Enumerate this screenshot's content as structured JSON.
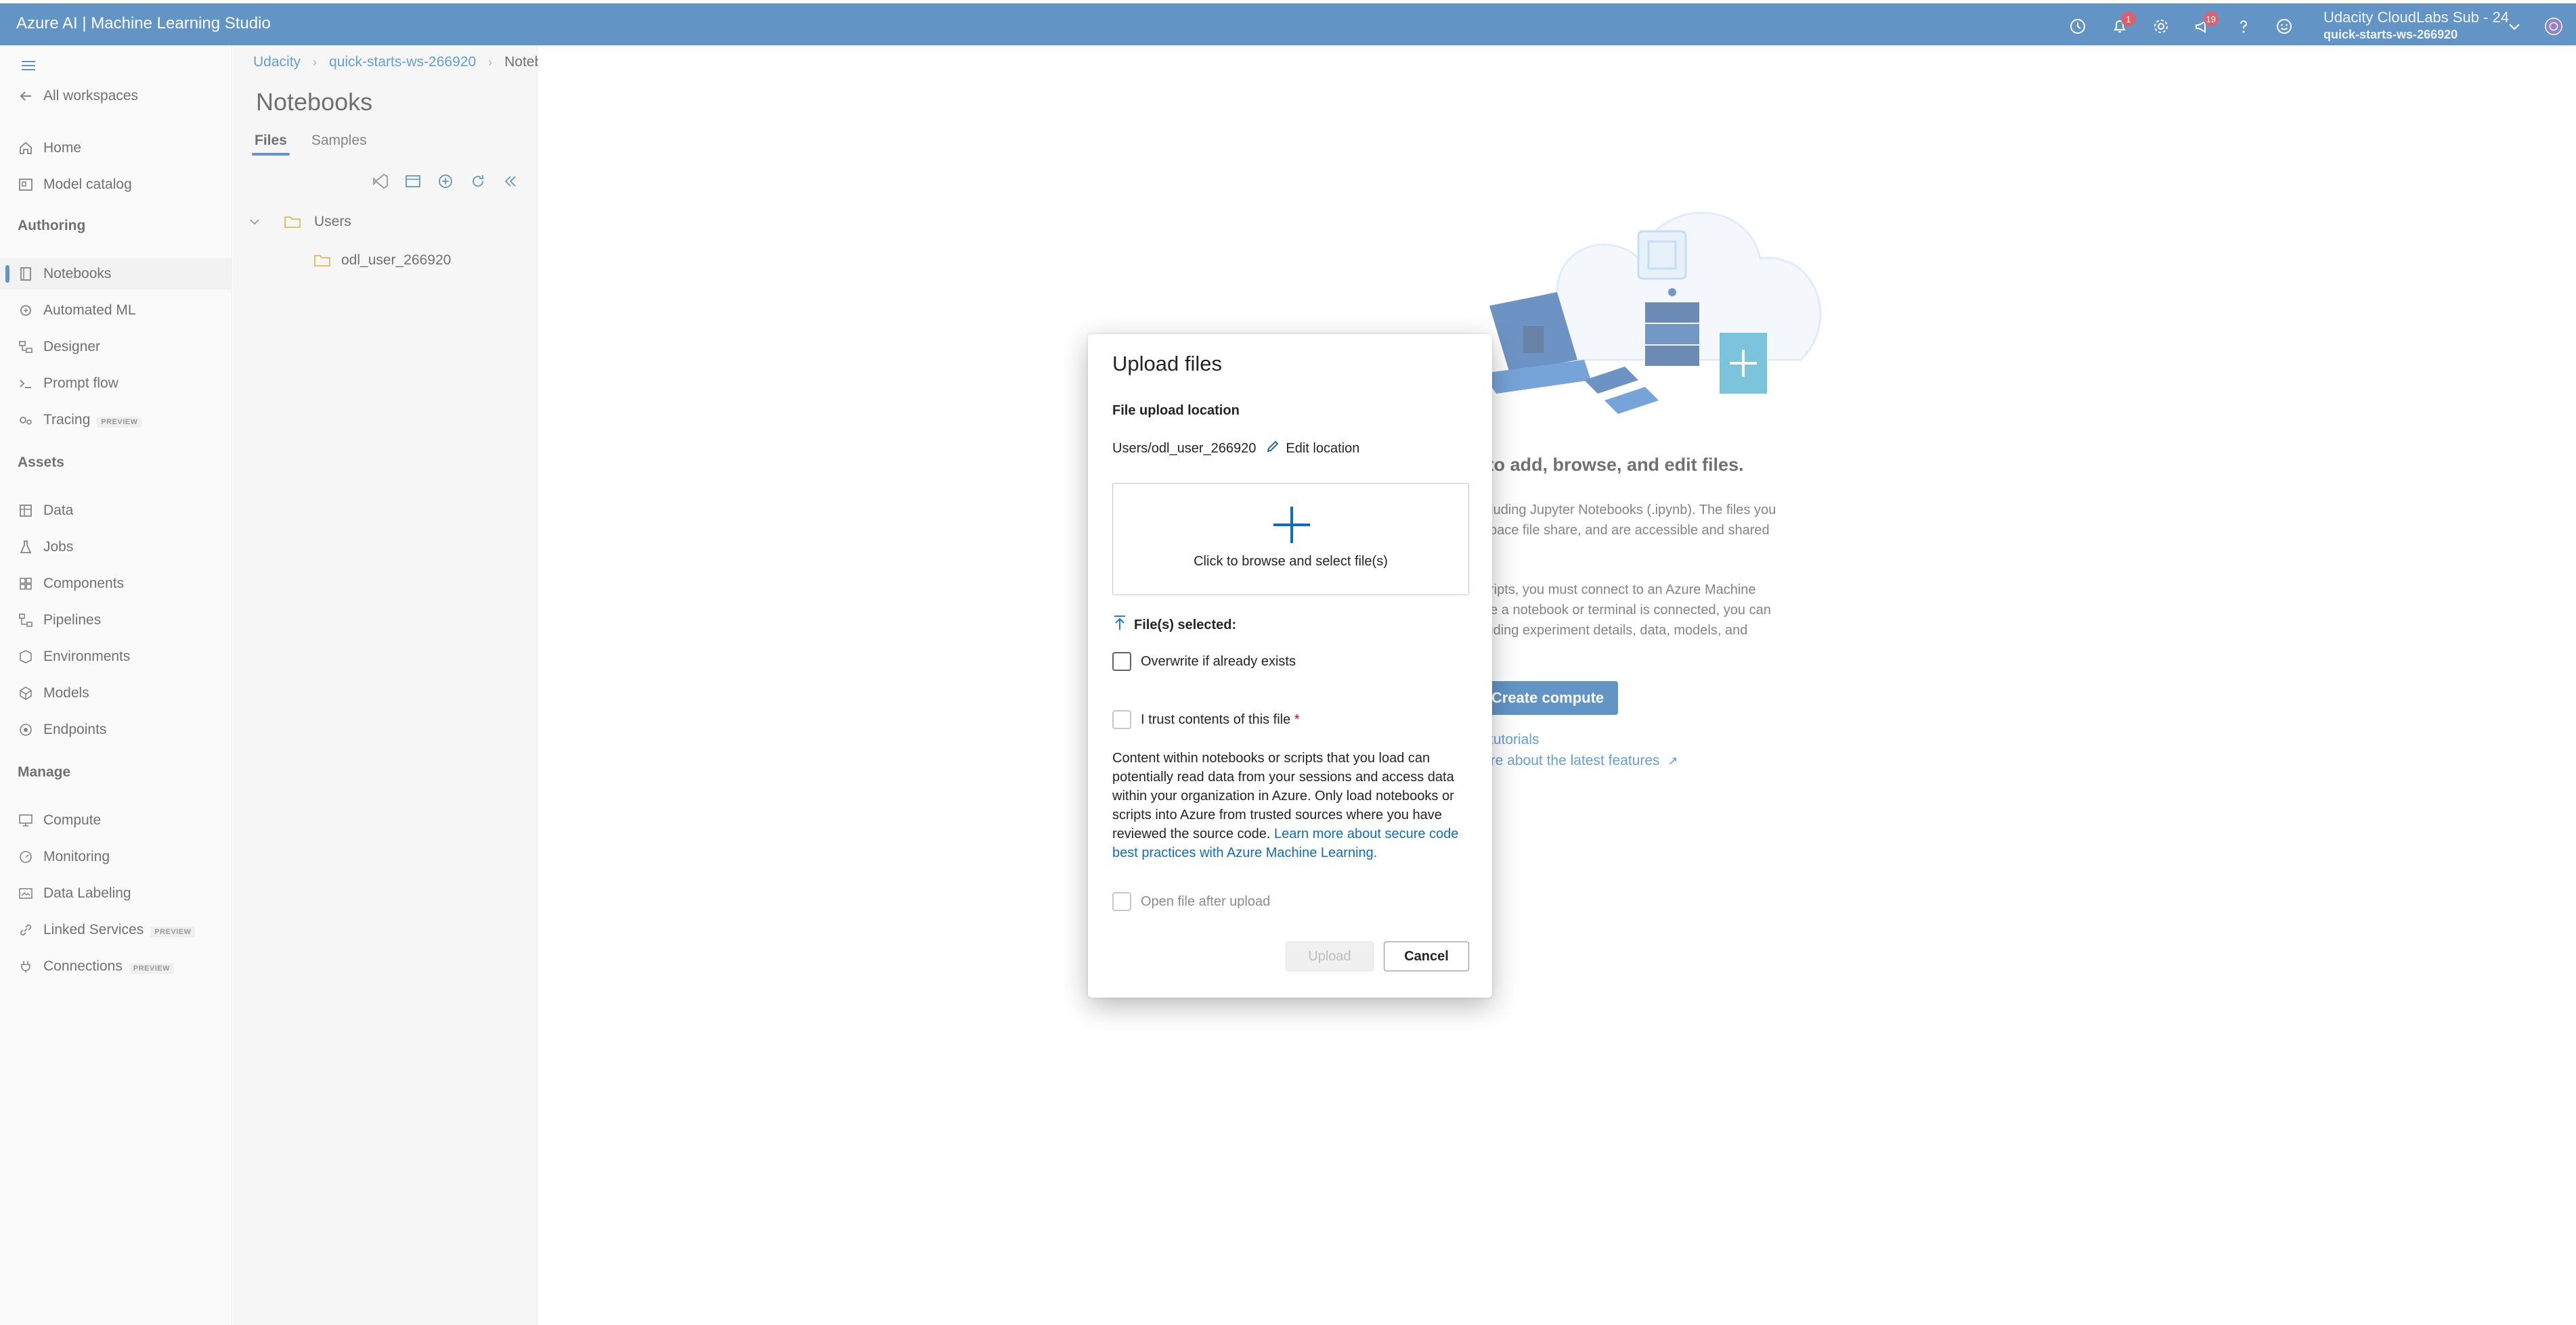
{
  "app": {
    "title": "Azure AI | Machine Learning Studio"
  },
  "header": {
    "notifications_count": "1",
    "feedback_count": "19",
    "account_name": "Udacity CloudLabs Sub - 24",
    "workspace": "quick-starts-ws-266920"
  },
  "nav": {
    "all_workspaces": "All workspaces",
    "home": "Home",
    "model_catalog": "Model catalog",
    "authoring_header": "Authoring",
    "notebooks": "Notebooks",
    "automated_ml": "Automated ML",
    "designer": "Designer",
    "prompt_flow": "Prompt flow",
    "tracing": "Tracing",
    "assets_header": "Assets",
    "data": "Data",
    "jobs": "Jobs",
    "components": "Components",
    "pipelines": "Pipelines",
    "environments": "Environments",
    "models": "Models",
    "endpoints": "Endpoints",
    "manage_header": "Manage",
    "compute": "Compute",
    "monitoring": "Monitoring",
    "data_labeling": "Data Labeling",
    "linked_services": "Linked Services",
    "connections": "Connections",
    "preview_badge": "PREVIEW"
  },
  "breadcrumb": {
    "org": "Udacity",
    "workspace": "quick-starts-ws-266920",
    "current": "Notebooks"
  },
  "notebooks": {
    "title": "Notebooks",
    "tab_files": "Files",
    "tab_samples": "Samples",
    "tree_users": "Users",
    "tree_user_folder": "odl_user_266920"
  },
  "main": {
    "hero_title": "ce to add, browse, and edit files.",
    "para1_line1": "ncluding Jupyter Notebooks (.ipynb). The files you",
    "para1_line2": "kspace file share, and are accessible and shared",
    "para2_line1": " scripts, you must connect to an Azure Machine",
    "para2_line2": "nce a notebook or terminal is connected, you can",
    "para2_line3": "cluding experiment details, data, models, and",
    "create_compute": "Create compute",
    "tutorials_link": "tutorials",
    "latest_features_link": "ore about the latest features"
  },
  "dialog": {
    "title": "Upload files",
    "location_label": "File upload location",
    "location_path": "Users/odl_user_266920",
    "edit_location": "Edit location",
    "dropzone_text": "Click to browse and select file(s)",
    "files_selected": "File(s) selected:",
    "overwrite_label": "Overwrite if already exists",
    "trust_label": "I trust contents of this file",
    "required_mark": "*",
    "disclaimer": "Content within notebooks or scripts that you load can potentially read data from your sessions and access data within your organization in Azure. Only load notebooks or scripts into Azure from trusted sources where you have reviewed the source code.",
    "learn_more": "Learn more about secure code best practices with Azure Machine Learning.",
    "open_after_upload": "Open file after upload",
    "upload_button": "Upload",
    "cancel_button": "Cancel"
  },
  "colors": {
    "topbar": "#0f5ca8",
    "link": "#0f6cbd",
    "badge": "#c50f1f",
    "folder_icon": "#c19c00"
  }
}
